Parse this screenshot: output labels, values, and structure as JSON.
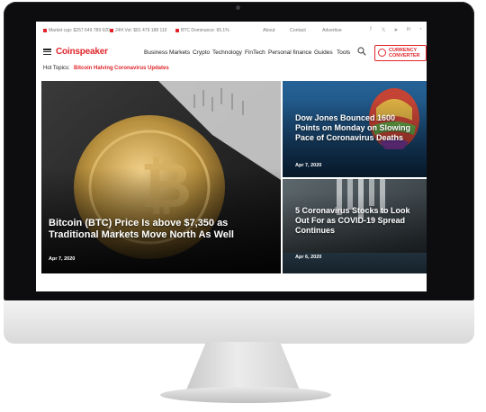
{
  "topbar": {
    "market_cap": "Market cap: $257 649 789 020",
    "vol_24h": "24H Vol: $81 479 188 110",
    "btc_dominance": "BTC Dominance: 65.1%",
    "links": [
      "About",
      "Contact",
      "Advertise"
    ],
    "social_icons": [
      "facebook-icon",
      "twitter-icon",
      "telegram-icon",
      "linkedin-icon",
      "rss-icon"
    ]
  },
  "nav": {
    "logo": "Coinspeaker",
    "items": [
      "Business",
      "Markets",
      "Crypto",
      "Technology",
      "FinTech",
      "Personal finance",
      "Guides",
      "Tools"
    ],
    "currency_converter": [
      "CURRENCY",
      "CONVERTER"
    ]
  },
  "hot_topics": {
    "label": "Hot Topics:",
    "links": [
      "Bitcoin Halving",
      "Coronavirus Updates"
    ]
  },
  "articles": {
    "main": {
      "title": "Bitcoin (BTC) Price Is above $7,350 as Traditional Markets Move North As Well",
      "date": "Apr 7, 2020"
    },
    "side1": {
      "title": "Dow Jones Bounced 1600 Points on Monday on Slowing Pace of Coronavirus Deaths",
      "date": "Apr 7, 2020"
    },
    "side2": {
      "title": "5 Coronavirus Stocks to Look Out For as COVID-19 Spread Continues",
      "date": "Apr 6, 2020"
    }
  },
  "colors": {
    "brand": "#e0262b",
    "bezel": "#0d0d0f"
  }
}
